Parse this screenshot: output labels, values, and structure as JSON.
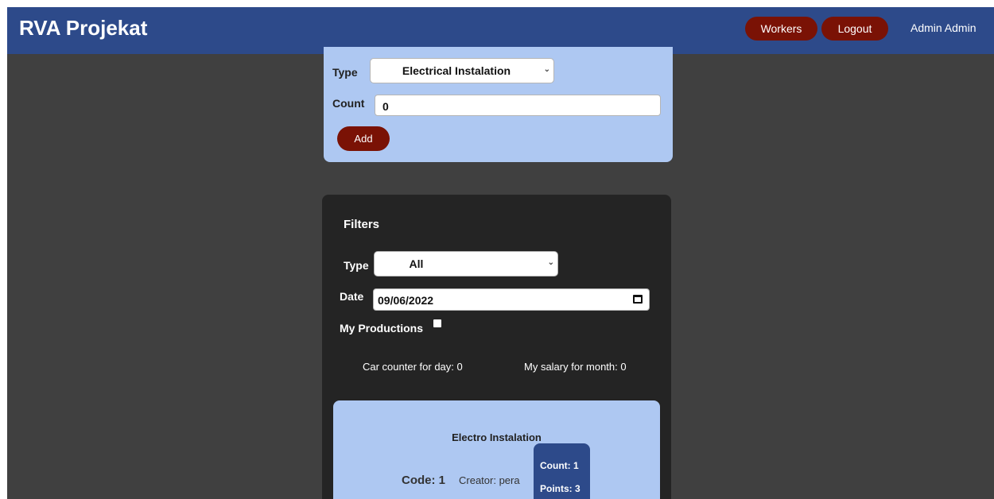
{
  "navbar": {
    "brand": "RVA Projekat",
    "workers_label": "Workers",
    "logout_label": "Logout",
    "user_name": "Admin Admin"
  },
  "add_form": {
    "type_label": "Type",
    "type_value": "Electrical Instalation",
    "count_label": "Count",
    "count_value": "0",
    "add_label": "Add"
  },
  "filters": {
    "title": "Filters",
    "type_label": "Type",
    "type_value": "All",
    "date_label": "Date",
    "date_value": "09/06/2022",
    "my_productions_label": "My Productions",
    "my_productions_checked": false,
    "car_counter": "Car counter for day: 0",
    "salary": "My salary for month: 0"
  },
  "production": {
    "title": "Electro Instalation",
    "code": "Code: 1",
    "creator": "Creator: pera",
    "count": "Count: 1",
    "points": "Points: 3"
  },
  "colors": {
    "navbar": "#2d4a8a",
    "button": "#7a1205",
    "card": "#aec8f2",
    "panel": "#242424",
    "background": "#404040"
  }
}
